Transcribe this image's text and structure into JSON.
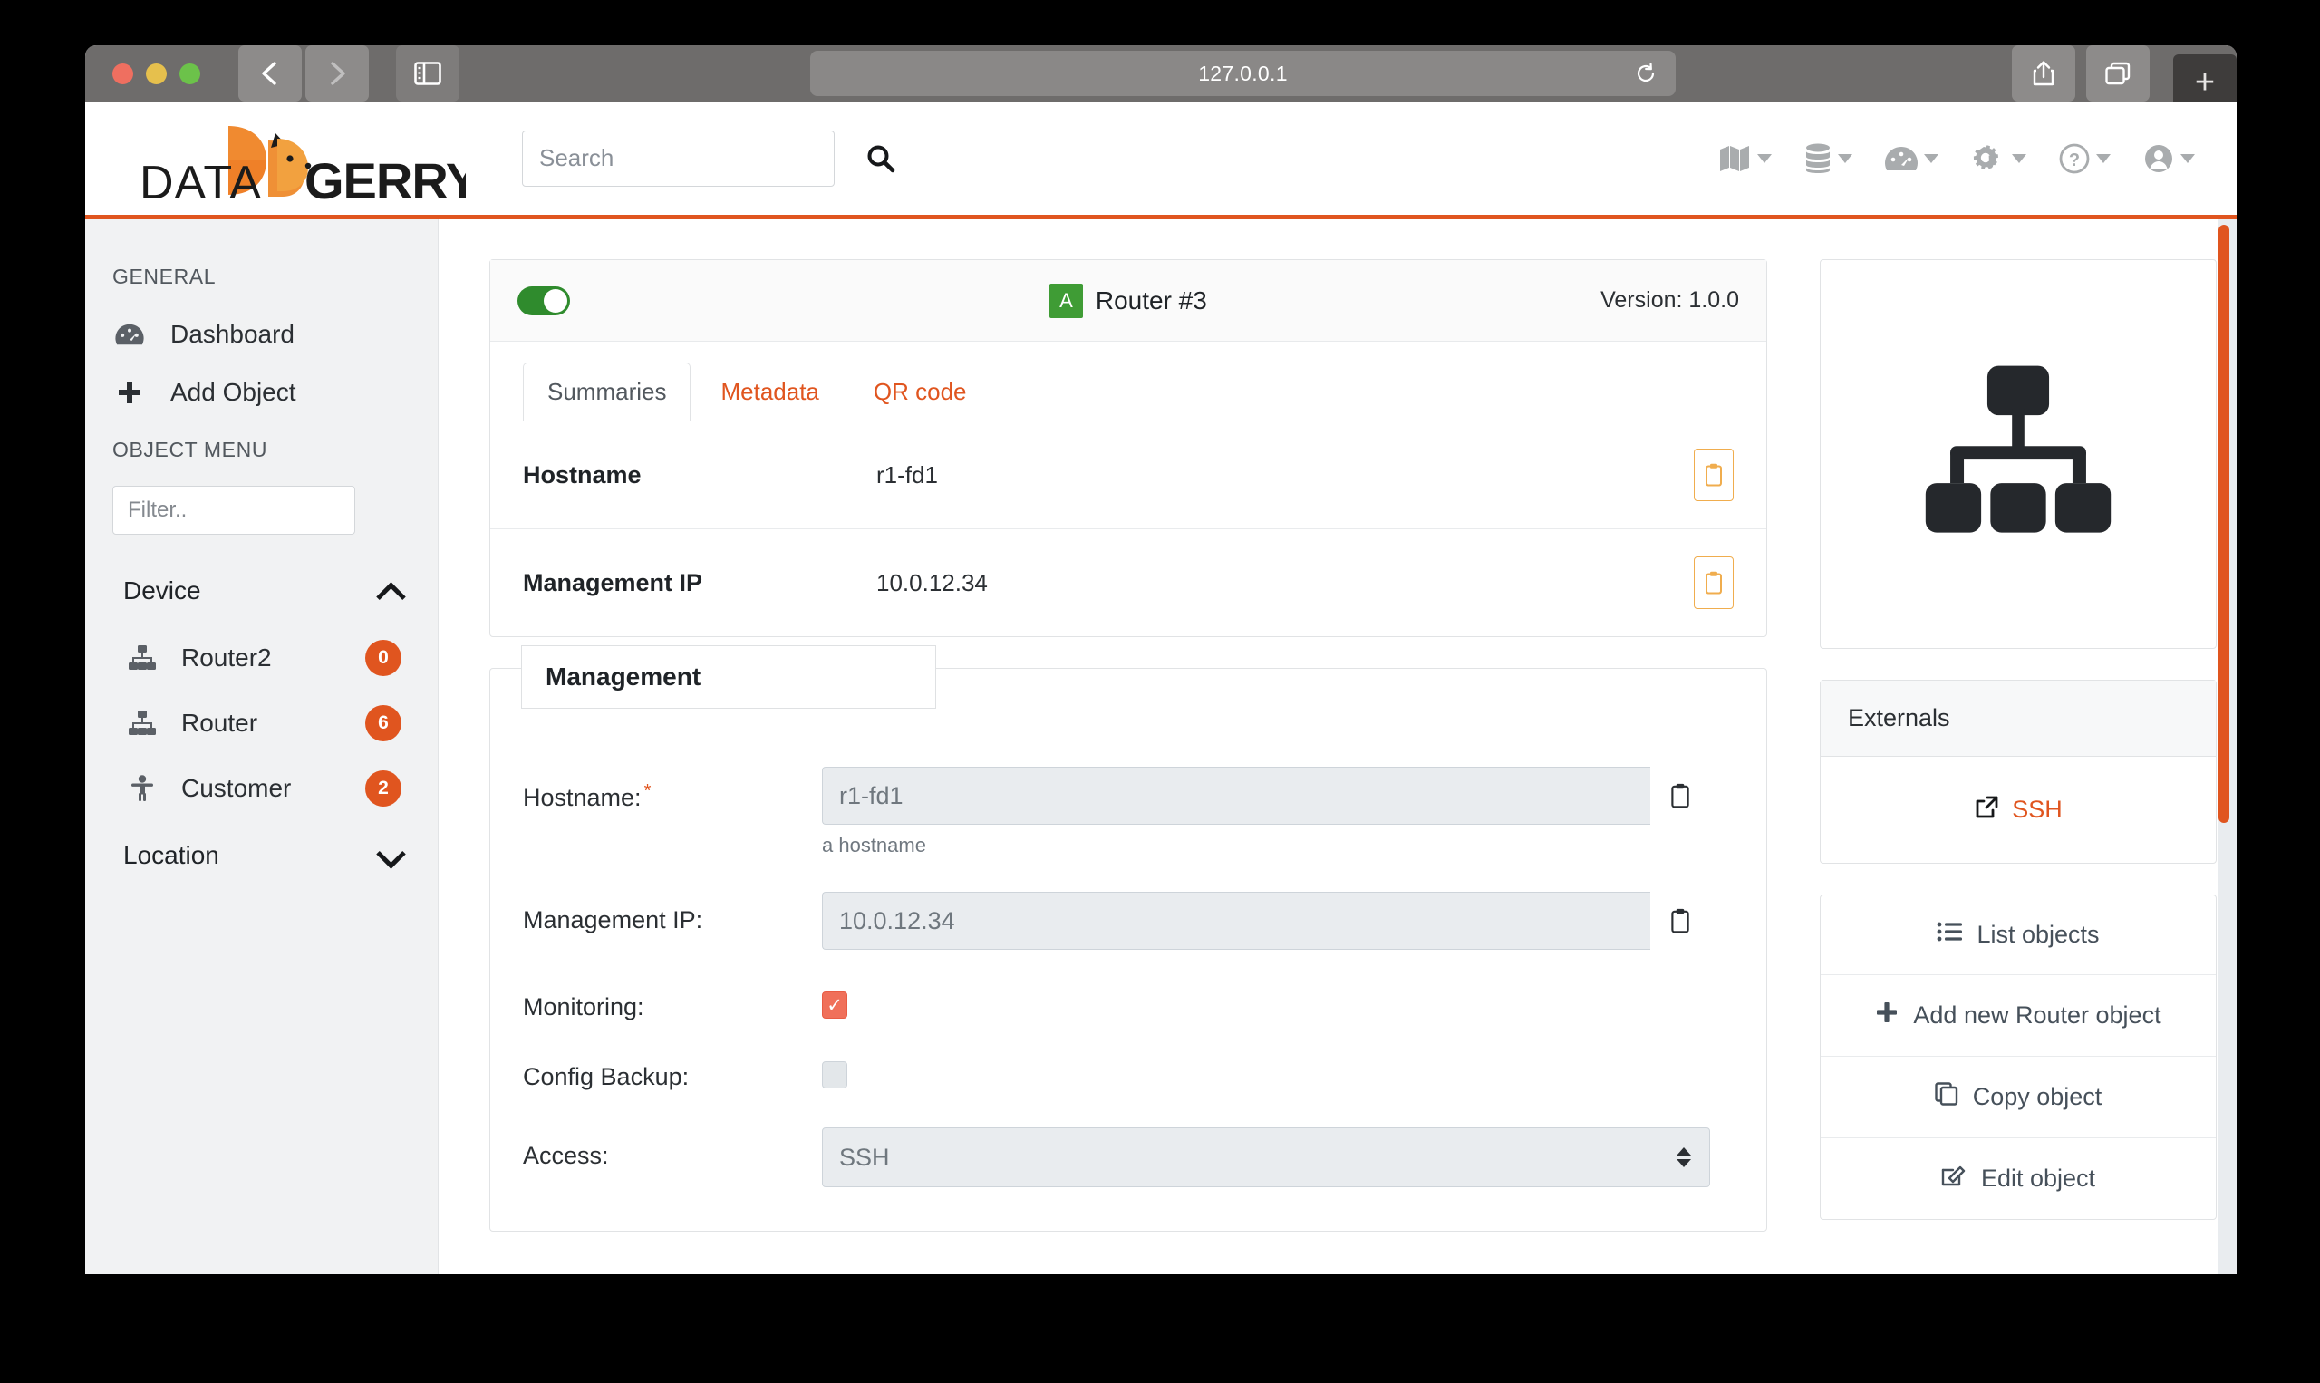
{
  "browser": {
    "url": "127.0.0.1",
    "back_label": "Back",
    "forward_label": "Forward",
    "sidebar_label": "Show sidebar",
    "reload_label": "Reload",
    "share_label": "Share",
    "tabs_label": "Show tab overview",
    "newtab_label": "+"
  },
  "header": {
    "logo_text_light": "DATA",
    "logo_text_bold": "GERRY",
    "search": {
      "placeholder": "Search",
      "value": ""
    },
    "icons": [
      {
        "name": "map-icon",
        "label": "Map"
      },
      {
        "name": "database-icon",
        "label": "Database"
      },
      {
        "name": "tachometer-icon",
        "label": "Monitoring"
      },
      {
        "name": "cogs-icon",
        "label": "Settings"
      },
      {
        "name": "question-circle-icon",
        "label": "Help"
      },
      {
        "name": "user-circle-icon",
        "label": "Account"
      }
    ],
    "accent_color": "#e0551f"
  },
  "sidebar": {
    "general_heading": "GENERAL",
    "general_items": [
      {
        "icon": "tachometer-icon",
        "label": "Dashboard"
      },
      {
        "icon": "plus-icon",
        "label": "Add Object"
      }
    ],
    "object_menu_heading": "OBJECT MENU",
    "filter": {
      "placeholder": "Filter..",
      "value": ""
    },
    "groups": [
      {
        "label": "Device",
        "expanded": true,
        "items": [
          {
            "icon": "sitemap-icon",
            "label": "Router2",
            "badge": "0"
          },
          {
            "icon": "sitemap-icon",
            "label": "Router",
            "badge": "6"
          },
          {
            "icon": "child-icon",
            "label": "Customer",
            "badge": "2"
          }
        ]
      },
      {
        "label": "Location",
        "expanded": false,
        "items": []
      }
    ],
    "badge_color": "#e0551f"
  },
  "object": {
    "active": true,
    "type_badge": "A",
    "title": "Router #3",
    "version_label": "Version: 1.0.0",
    "tabs": [
      {
        "label": "Summaries",
        "active": true
      },
      {
        "label": "Metadata",
        "active": false
      },
      {
        "label": "QR code",
        "active": false
      }
    ],
    "summaries": [
      {
        "label": "Hostname",
        "value": "r1-fd1",
        "copy": "copy-icon"
      },
      {
        "label": "Management IP",
        "value": "10.0.12.34",
        "copy": "copy-icon"
      }
    ],
    "status_color": "#3f9c35"
  },
  "management": {
    "legend": "Management",
    "fields": [
      {
        "type": "text",
        "label": "Hostname:",
        "required": true,
        "value": "r1-fd1",
        "hint": "a hostname",
        "copy": "copy-icon"
      },
      {
        "type": "text",
        "label": "Management IP:",
        "required": false,
        "value": "10.0.12.34",
        "hint": "",
        "copy": "copy-icon"
      },
      {
        "type": "checkbox",
        "label": "Monitoring:",
        "checked": true,
        "mark": "✓"
      },
      {
        "type": "checkbox",
        "label": "Config Backup:",
        "checked": false,
        "mark": ""
      },
      {
        "type": "select",
        "label": "Access:",
        "value": "SSH"
      }
    ]
  },
  "rightpanel": {
    "type_icon": "sitemap-icon",
    "externals_title": "Externals",
    "externals": [
      {
        "icon": "external-link-icon",
        "label": "SSH",
        "color": "#e0551f"
      }
    ],
    "actions": [
      {
        "icon": "list-icon",
        "label": "List objects"
      },
      {
        "icon": "plus-icon",
        "label": "Add new Router object"
      },
      {
        "icon": "copy-icon",
        "label": "Copy object"
      },
      {
        "icon": "edit-icon",
        "label": "Edit object"
      }
    ]
  }
}
